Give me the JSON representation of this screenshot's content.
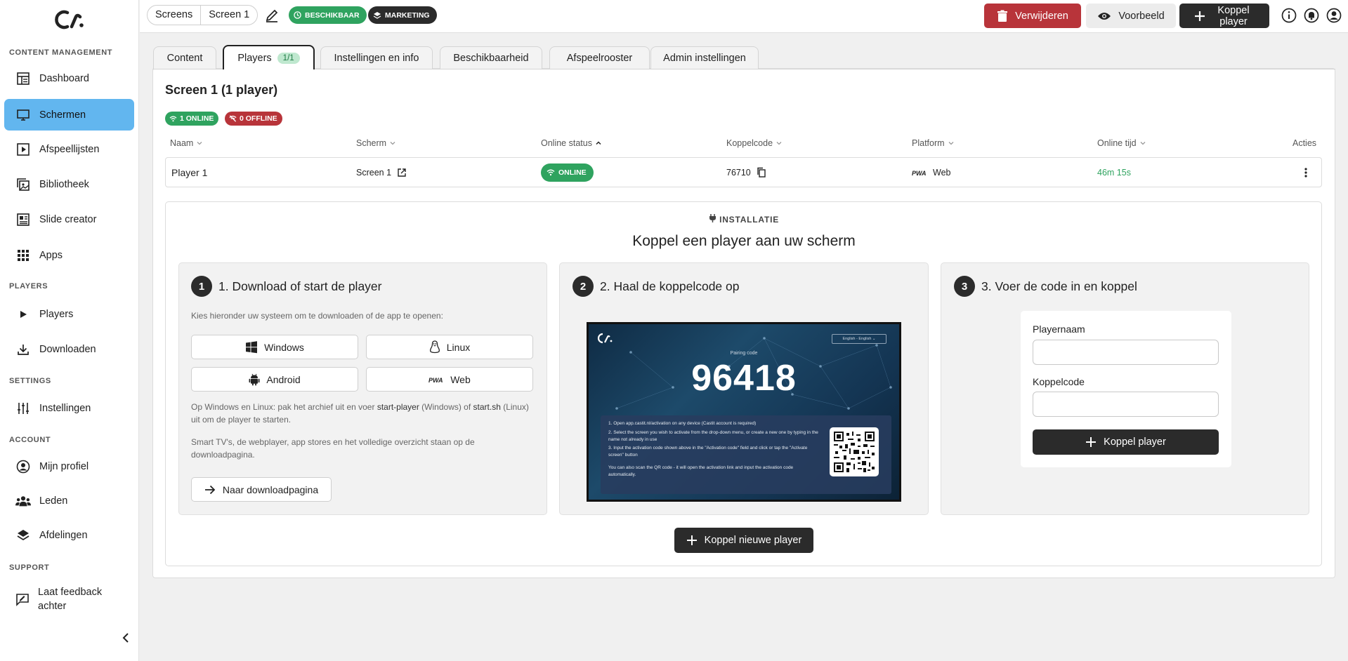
{
  "sidebar": {
    "sections": {
      "content": "CONTENT MANAGEMENT",
      "players": "PLAYERS",
      "settings": "SETTINGS",
      "account": "ACCOUNT",
      "support": "SUPPORT"
    },
    "items": {
      "dashboard": "Dashboard",
      "schermen": "Schermen",
      "afspeellijsten": "Afspeellijsten",
      "bibliotheek": "Bibliotheek",
      "slide_creator": "Slide creator",
      "apps": "Apps",
      "players": "Players",
      "downloaden": "Downloaden",
      "instellingen": "Instellingen",
      "mijn_profiel": "Mijn profiel",
      "leden": "Leden",
      "afdelingen": "Afdelingen",
      "feedback": "Laat feedback achter"
    },
    "active_color": "#62b6ef"
  },
  "topbar": {
    "breadcrumb": [
      "Screens",
      "Screen 1"
    ],
    "status_pill": "BESCHIKBAAR",
    "tag_pill": "MARKETING",
    "delete_label": "Verwijderen",
    "preview_label": "Voorbeeld",
    "koppel_label": "Koppel player",
    "colors": {
      "danger": "#b8343a",
      "success": "#2fa35f",
      "dark": "#2b2b2b"
    }
  },
  "tabs": [
    {
      "label": "Content"
    },
    {
      "label": "Players",
      "count": "1/1"
    },
    {
      "label": "Instellingen en info"
    },
    {
      "label": "Beschikbaarheid"
    },
    {
      "label": "Afspeelrooster"
    },
    {
      "label": "Admin instellingen"
    }
  ],
  "screen": {
    "title": "Screen 1 (1 player)",
    "online_badge": "1 ONLINE",
    "offline_badge": "0 OFFLINE"
  },
  "table": {
    "headers": {
      "naam": "Naam",
      "scherm": "Scherm",
      "online_status": "Online status",
      "koppelcode": "Koppelcode",
      "platform": "Platform",
      "online_tijd": "Online tijd",
      "acties": "Acties"
    },
    "rows": [
      {
        "naam": "Player 1",
        "scherm": "Screen 1",
        "status": "ONLINE",
        "koppelcode": "76710",
        "platform": "Web",
        "online_tijd": "46m 15s"
      }
    ]
  },
  "install": {
    "kicker": "INSTALLATIE",
    "title": "Koppel een player aan uw scherm",
    "step1": {
      "number": "1",
      "title": "1. Download of start de player",
      "intro": "Kies hieronder uw systeem om te downloaden of de app te openen:",
      "os": {
        "windows": "Windows",
        "linux": "Linux",
        "android": "Android",
        "web": "Web"
      },
      "note1_a": "Op Windows en Linux: pak het archief uit en voer ",
      "note1_b": "start-player",
      "note1_c": " (Windows) of ",
      "note1_d": "start.sh",
      "note1_e": " (Linux) uit om de player te starten.",
      "note2": "Smart TV's, de webplayer, app stores en het volledige overzicht staan op de downloadpagina.",
      "download_btn": "Naar downloadpagina"
    },
    "step2": {
      "number": "2",
      "title": "2. Haal de koppelcode op",
      "tv": {
        "language": "English - English",
        "pairing_label": "Pairing code",
        "pairing_code": "96418",
        "steps": [
          "1. Open app.castit.nl/activation on any device (Castit account is required)",
          "2. Select the screen you wish to activate from the drop-down menu, or create a new one by typing in the name not already in use",
          "3. Input the activation code shown above in the \"Activation code\" field and click or tap the \"Activate screen\" button",
          "You can also scan the QR code - it will open the activation link and input the activation code automatically."
        ]
      }
    },
    "step3": {
      "number": "3",
      "title": "3. Voer de code in en koppel",
      "playername_label": "Playernaam",
      "playername_value": "",
      "koppelcode_label": "Koppelcode",
      "koppelcode_value": "",
      "submit": "Koppel player"
    },
    "new_player_btn": "Koppel nieuwe player"
  }
}
